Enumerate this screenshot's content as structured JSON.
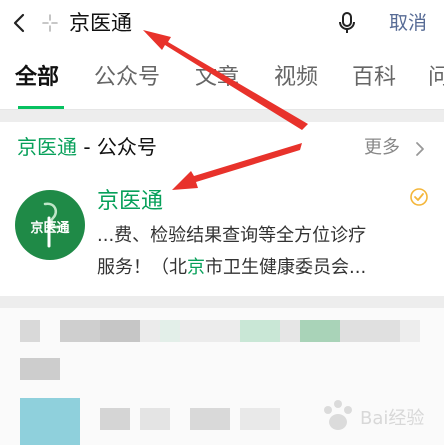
{
  "search": {
    "query": "京医通",
    "cancel_label": "取消"
  },
  "tabs": [
    {
      "label": "全部",
      "active": true
    },
    {
      "label": "公众号"
    },
    {
      "label": "文章"
    },
    {
      "label": "视频"
    },
    {
      "label": "百科"
    },
    {
      "label": "问"
    }
  ],
  "section": {
    "title_highlight": "京医通",
    "title_rest": " - 公众号",
    "more_label": "更多"
  },
  "result": {
    "name": "京医通",
    "desc_line1": "...费、检验结果查询等全方位诊疗",
    "desc_line2_a": "服务！（北",
    "desc_line2_hl": "京",
    "desc_line2_b": "市卫生健康委员会...",
    "avatar_text": "京医通"
  },
  "watermark": {
    "text": "Bai经验"
  },
  "colors": {
    "accent_green": "#07c160",
    "highlight_green": "#07a05a",
    "link_blue": "#576b95",
    "arrow_red": "#e8322b",
    "avatar_bg": "#1f8a47",
    "verified_gold": "#f4b63a"
  }
}
